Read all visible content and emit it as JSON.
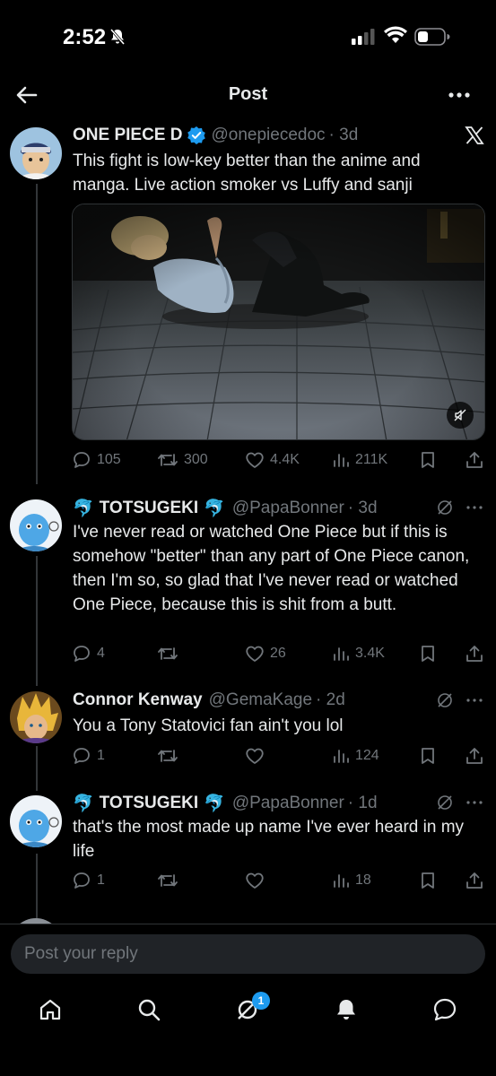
{
  "status_bar": {
    "time": "2:52"
  },
  "header": {
    "title": "Post"
  },
  "main_post": {
    "name": "ONE PIECE D",
    "handle": "@onepiecedoc",
    "age": "· 3d",
    "text": "This fight is low-key better than the anime and manga. Live action smoker vs Luffy and sanji",
    "actions": {
      "replies": "105",
      "reposts": "300",
      "likes": "4.4K",
      "views": "211K"
    }
  },
  "replies": [
    {
      "name": "TOTSUGEKI",
      "emoji": "🐬",
      "handle": "@PapaBonner",
      "age": "· 3d",
      "text": "I've never read or watched One Piece but if this is somehow \"better\" than any part of One Piece canon, then I'm so, so glad that I've never read or watched One Piece, because this is shit from a butt.",
      "actions": {
        "replies": "4",
        "reposts": "",
        "likes": "26",
        "views": "3.4K"
      }
    },
    {
      "name": "Connor Kenway",
      "handle": "@GemaKage",
      "age": "· 2d",
      "text": "You a Tony Statovici fan ain't you lol",
      "actions": {
        "replies": "1",
        "reposts": "",
        "likes": "",
        "views": "124"
      }
    },
    {
      "name": "TOTSUGEKI",
      "emoji": "🐬",
      "handle": "@PapaBonner",
      "age": "· 1d",
      "text": "that's the most made up name I've ever heard in my life",
      "actions": {
        "replies": "1",
        "reposts": "",
        "likes": "",
        "views": "18"
      }
    }
  ],
  "composer": {
    "placeholder": "Post your reply"
  },
  "tabbar": {
    "notifications_badge": "1"
  },
  "colors": {
    "accent": "#1d9bf0",
    "muted": "#71767b",
    "background": "#000000"
  }
}
